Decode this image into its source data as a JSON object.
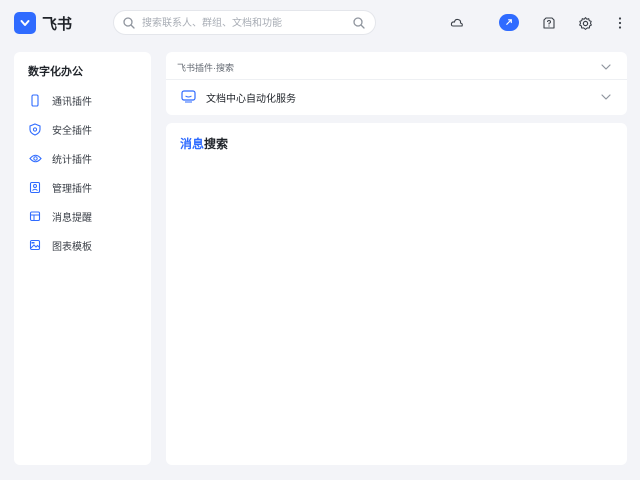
{
  "app": {
    "name": "飞书",
    "accent_color": "#2f6bff"
  },
  "search": {
    "placeholder": "搜索联系人、群组、文档和功能"
  },
  "sidebar": {
    "title": "数字化办公",
    "items": [
      {
        "label": "通讯插件",
        "icon": "phone-icon"
      },
      {
        "label": "安全插件",
        "icon": "shield-icon"
      },
      {
        "label": "统计插件",
        "icon": "eye-icon"
      },
      {
        "label": "管理插件",
        "icon": "contact-card-icon"
      },
      {
        "label": "消息提醒",
        "icon": "calendar-icon"
      },
      {
        "label": "图表模板",
        "icon": "image-icon"
      }
    ]
  },
  "top_panel": {
    "row1_label": "飞书插件·搜索",
    "row2_label": "文档中心自动化服务"
  },
  "main_panel": {
    "title_accent": "消息",
    "title_rest": "搜索"
  }
}
